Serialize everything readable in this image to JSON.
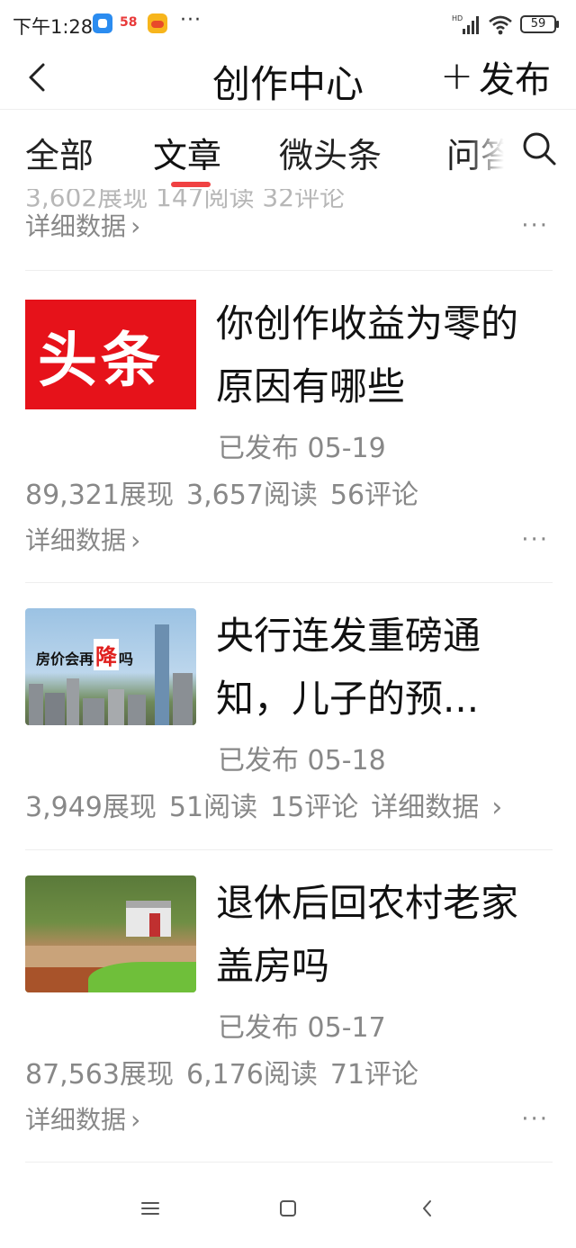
{
  "status_bar": {
    "time": "下午1:28",
    "app2_label": "58",
    "more": "···",
    "battery": "59"
  },
  "header": {
    "title": "创作中心",
    "publish_label": "发布",
    "plus": "+"
  },
  "tabs": [
    {
      "label": "全部"
    },
    {
      "label": "文章"
    },
    {
      "label": "微头条"
    },
    {
      "label": "问答"
    }
  ],
  "content": {
    "cut_stats": "3,602展现 147阅读 32评论",
    "detail_label": "详细数据",
    "chevron": "›",
    "more": "···",
    "articles": [
      {
        "title": "你创作收益为零的原因有哪些",
        "thumb_text": "头条",
        "status": "已发布",
        "date": "05-19",
        "impressions": "89,321展现",
        "reads": "3,657阅读",
        "comments": "56评论"
      },
      {
        "title": "央行连发重磅通知，儿子的预...",
        "thumb_text_a": "房价会再",
        "thumb_text_b": "降",
        "thumb_text_c": "吗",
        "status": "已发布",
        "date": "05-18",
        "impressions": "3,949展现",
        "reads": "51阅读",
        "comments": "15评论"
      },
      {
        "title": "退休后回农村老家盖房吗",
        "status": "已发布",
        "date": "05-17",
        "impressions": "87,563展现",
        "reads": "6,176阅读",
        "comments": "71评论"
      }
    ]
  },
  "colors": {
    "accent": "#f04142",
    "text": "#111111",
    "muted": "#888888"
  }
}
